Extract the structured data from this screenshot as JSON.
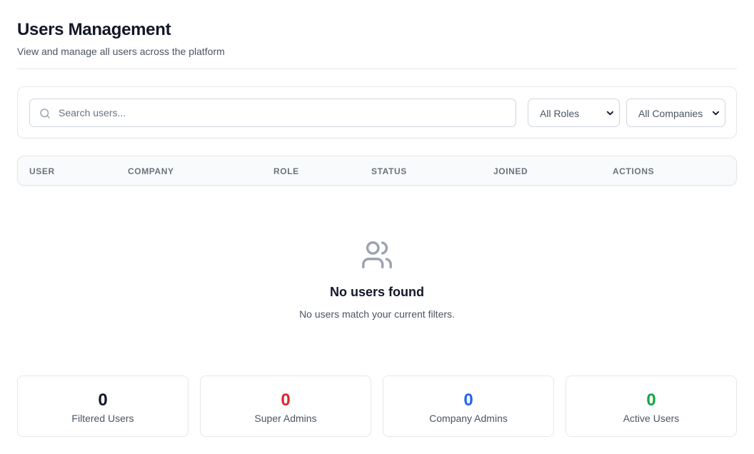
{
  "header": {
    "title": "Users Management",
    "subtitle": "View and manage all users across the platform"
  },
  "filters": {
    "search_placeholder": "Search users...",
    "search_value": "",
    "role_select": "All Roles",
    "company_select": "All Companies"
  },
  "table": {
    "columns": [
      "USER",
      "COMPANY",
      "ROLE",
      "STATUS",
      "JOINED",
      "ACTIONS"
    ]
  },
  "empty_state": {
    "icon": "users-icon",
    "title": "No users found",
    "message": "No users match your current filters."
  },
  "stats": [
    {
      "value": "0",
      "label": "Filtered Users",
      "color": "#111827"
    },
    {
      "value": "0",
      "label": "Super Admins",
      "color": "#dc2626"
    },
    {
      "value": "0",
      "label": "Company Admins",
      "color": "#2563eb"
    },
    {
      "value": "0",
      "label": "Active Users",
      "color": "#16a34a"
    }
  ]
}
